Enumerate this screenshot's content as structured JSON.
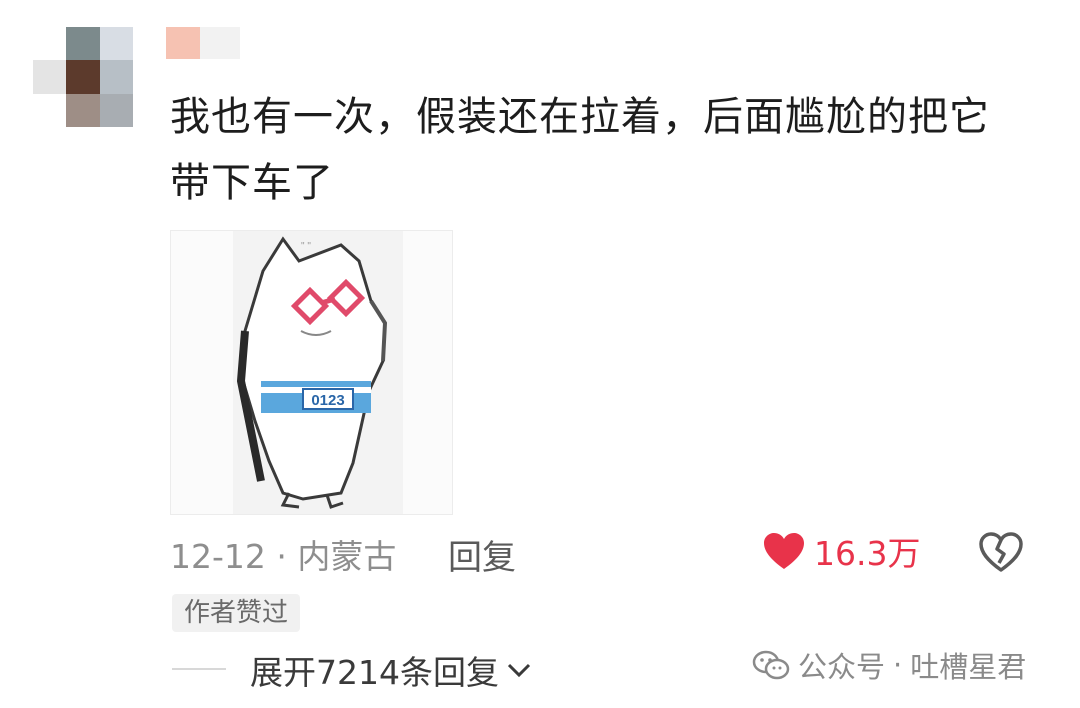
{
  "comment": {
    "text_line1": "我也有一次，假装还在拉着，后面尴尬的把它",
    "text_line2": "带下车了"
  },
  "sticker": {
    "badge_text": "0123"
  },
  "meta": {
    "date": "12-12",
    "separator": "·",
    "location": "内蒙古",
    "reply_label": "回复"
  },
  "like": {
    "count": "16.3万",
    "color": "#e8334a"
  },
  "author_badge": "作者赞过",
  "expand_replies": "展开7214条回复",
  "watermark": {
    "prefix": "公众号",
    "separator": "·",
    "name": "吐槽星君"
  }
}
